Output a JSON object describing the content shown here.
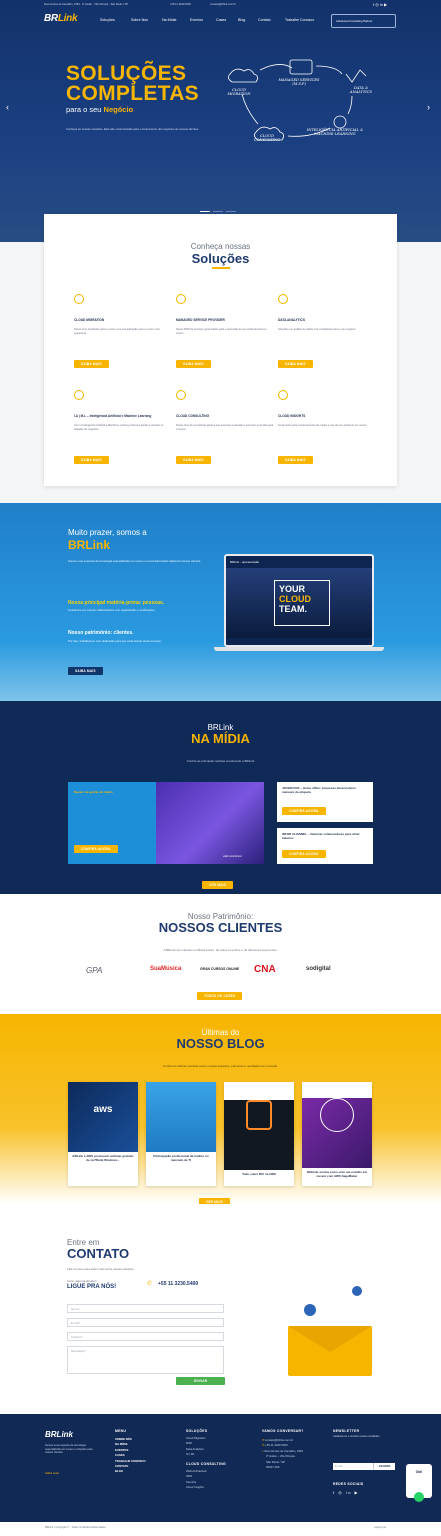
{
  "topbar": {
    "address": "Rua Gomes de Carvalho, 1581 · 3º Andar · Vila Olímpia · São Paulo / SP",
    "phone": "+55 11 3230-5400",
    "email": "contato@brlink.com.br"
  },
  "brand": {
    "logo_main": "BR",
    "logo_accent": "Link"
  },
  "nav": {
    "items": [
      "Soluções",
      "Sobre Nós",
      "Na Mídia",
      "Eventos",
      "Cases",
      "Blog",
      "Contato",
      "Trabalhe Conosco"
    ],
    "badge": "Advanced Consulting Partner"
  },
  "hero": {
    "title_line1": "SOLUÇÕES",
    "title_line2": "COMPLETAS",
    "sub_prefix": "para o seu ",
    "sub_bold": "Negócio",
    "desc": "Conheça as nossas soluções. Elas são customizadas para o crescimento dos negócios de nossos clientes.",
    "diagram": [
      "CLOUD MIGRATION",
      "MANAGED SERVICES (M.S.P)",
      "DATA & ANALYTICS",
      "INTELIGÊNCIA ARTIFICIAL & MACHINE LEARNING",
      "CLOUD CONSULTING"
    ]
  },
  "solutions": {
    "kicker": "Conheça nossas",
    "title": "Soluções",
    "cards": [
      {
        "title": "CLOUD MIGRATION",
        "desc": "Nosso time certificado para o mover com sua aplicação para a nuvem com segurança.",
        "btn": "SAIBA MAIS"
      },
      {
        "title": "MANAGED SERVICE PROVIDER",
        "desc": "Nosso MSP de serviços gerenciados para a operação de sua infraestrutura em nuvem.",
        "btn": "SAIBA MAIS"
      },
      {
        "title": "DATA ANALYTICS",
        "desc": "Soluções em análise de dados com inteligência para o seu negócio.",
        "btn": "SAIBA MAIS"
      },
      {
        "title": "I.A | M.L – Inteligência Artificial e Machine Learning",
        "desc": "Com a Inteligência Artificial e Machine Learning podemos ajudar a resolver os desafios de negócios.",
        "btn": "SAIBA MAIS"
      },
      {
        "title": "CLOUD CONSULTING",
        "desc": "Nosso time de consultoria ajuda a sua empresa a planejar e executar a jornada para a nuvem.",
        "btn": "SAIBA MAIS"
      },
      {
        "title": "CLOUD INSIGHTS",
        "desc": "Ferramenta para monitoramento de custos e uso de seu ambiente em nuvem.",
        "btn": "SAIBA MAIS"
      }
    ]
  },
  "about": {
    "kicker": "Muito prazer, somos a",
    "title": "BRLink",
    "p1": "Somos uma empresa de tecnologia especializada em nuvem e na transformação digital de nossos clientes.",
    "h1": "Nossa principal matéria-prima: pessoas.",
    "p2": "Investimos em nossos colaboradores com capacitação e certificações.",
    "h2": "Nosso patrimônio: clientes.",
    "p3": "Por isso, trabalhamos com dedicação para que cada cliente tenha sucesso.",
    "btn": "SAIBA MAIS",
    "video_title": "BRLink – apresentação",
    "video_text": [
      "YOUR",
      "CLOUD",
      "TEAM."
    ]
  },
  "media": {
    "kicker": "BRLink",
    "title": "NA MÍDIA",
    "sub": "Confira as principais notícias envolvendo a BRLink",
    "featured_title": "Nuvem na gestão de dados",
    "featured_btn": "CONFIRA AGORA",
    "featured_caption": "valor econômico",
    "items": [
      {
        "title": "JOVEM PAN – Home office: empresas desenvolvem manuais de etiqueta",
        "btn": "CONFIRA AGORA"
      },
      {
        "title": "INFOR CHANNEL – Valorizar colaboradores para atrair talentos",
        "btn": "CONFIRA AGORA"
      }
    ],
    "more_btn": "VER MAIS"
  },
  "clients": {
    "kicker": "Nosso Patrimônio:",
    "title": "NOSSOS CLIENTES",
    "sub": "A BRLink tem clientes no Brasil inteiro, de todos os portes e de diferentes segmentos.",
    "logos": [
      "GPA",
      "SuaMúsica",
      "GRAN CURSOS ONLINE",
      "CNA",
      "sodigital"
    ],
    "btn": "TODOS OS CASES"
  },
  "blog": {
    "kicker": "Últimas do",
    "title": "NOSSO BLOG",
    "sub": "Confira as últimas notícias sobre nossas soluções, parcerias e novidades do mercado.",
    "posts": [
      {
        "title": "BRLink e AWS promovem webinar gratuito de nuTRank Windows...",
        "img_text": "aws"
      },
      {
        "title": "Participação profissional da mulher no mercado de TI"
      },
      {
        "title": "Tudo sobre RIX na AWS"
      },
      {
        "title": "Webinar ensina como criar um estúdio em nuvem com AWS SageMaker"
      }
    ],
    "btn": "VER MAIS"
  },
  "contact": {
    "kicker": "Entre em",
    "title": "CONTATO",
    "intro": "Fale conosco para saber mais sobre nossas soluções.",
    "call_small": "Você, alguma dúvida?",
    "call_big": "LIGUE PRA NÓS!",
    "phone": "+55 11 3230.5400",
    "fields": [
      "Nome*",
      "E-mail*",
      "Telefone*",
      "Mensagem*"
    ],
    "submit": "ENVIAR"
  },
  "footer": {
    "logo": "BRLink",
    "about": "Somos uma empresa de tecnologia especializada em nuvem e soluções para nossos clientes.",
    "about_link": "Saiba mais",
    "menu_title": "MENU",
    "menu": [
      "SOBRE NÓS",
      "NA MÍDIA",
      "EVENTOS",
      "CASES",
      "TRABALHE CONOSCO",
      "CONTATO",
      "BLOG"
    ],
    "sol_title": "SOLUÇÕES",
    "sol": [
      "Cloud Migration",
      "MSP",
      "Data Analytics",
      "IA | ML"
    ],
    "consult_title": "CLOUD CONSULTING",
    "consult": [
      "Well-Architected",
      "AWS",
      "Security",
      "Cloud Insights"
    ],
    "talk_title": "VAMOS CONVERSAR?",
    "talk_email": "contato@brlink.com.br",
    "talk_phone": "+55 11 3230.5400",
    "talk_addr": [
      "Rua Gomes de Carvalho, 1581",
      "3º Andar – Vila Olímpia",
      "São Paulo / SP",
      "04547-006"
    ],
    "news_title": "NEWSLETTER",
    "news_text": "Cadastre-se e receba nossas novidades.",
    "news_placeholder": "E-mail",
    "news_btn": "ASSINAR",
    "social_title": "REDES SOCIAIS",
    "chat": "Olá!"
  },
  "bottom": {
    "copy": "BRLink | Copyright © - Todos os direitos Reservados.",
    "credit": "Layout por"
  }
}
